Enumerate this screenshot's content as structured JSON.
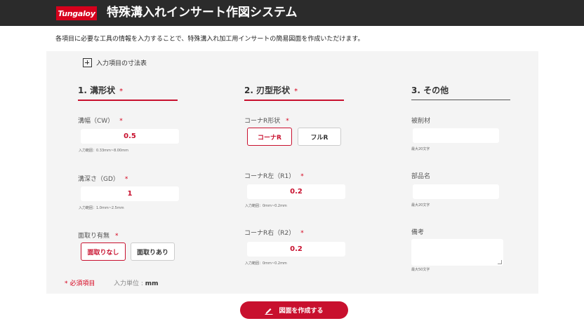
{
  "header": {
    "logo_text": "Tungaloy",
    "title": "特殊溝入れインサート作図システム",
    "bg_color": "#2b2b2b",
    "brand_color": "#d6001c"
  },
  "intro": "各項目に必要な工具の情報を入力することで、特殊溝入れ加工用インサートの簡易図面を作成いただけます。",
  "dims_toggle": {
    "label": "入力項目の寸法表",
    "icon": "plus-square-icon"
  },
  "section1": {
    "title": "1. 溝形状",
    "required_mark": "*",
    "groove_width": {
      "label": "溝幅（CW）",
      "required_mark": "*",
      "value": "0.5",
      "hint": "入力範囲：0.33mm~8.00mm"
    },
    "groove_depth": {
      "label": "溝深さ（GD）",
      "required_mark": "*",
      "value": "1",
      "hint": "入力範囲：1.0mm~2.5mm"
    },
    "chamfer": {
      "label": "面取り有無",
      "required_mark": "*",
      "options": [
        "面取りなし",
        "面取りあり"
      ],
      "selected": "面取りなし"
    }
  },
  "section2": {
    "title": "2. 刃型形状",
    "required_mark": "*",
    "corner_shape": {
      "label": "コーナR形状",
      "required_mark": "*",
      "options": [
        "コーナR",
        "フルR"
      ],
      "selected": "コーナR"
    },
    "corner_left": {
      "label": "コーナR左（R1）",
      "required_mark": "*",
      "value": "0.2",
      "hint": "入力範囲：0mm~0.2mm"
    },
    "corner_right": {
      "label": "コーナR右（R2）",
      "required_mark": "*",
      "value": "0.2",
      "hint": "入力範囲：0mm~0.2mm"
    }
  },
  "section3": {
    "title": "3. その他",
    "work_material": {
      "label": "被削材",
      "value": "",
      "hint": "最大20文字"
    },
    "part_name": {
      "label": "部品名",
      "value": "",
      "hint": "最大20文字"
    },
    "remarks": {
      "label": "備考",
      "value": "",
      "hint": "最大50文字"
    }
  },
  "legend": {
    "required_text": "* 必須項目",
    "unit_label": "入力単位 : ",
    "unit_value": "mm"
  },
  "submit": {
    "label": "図面を作成する",
    "icon": "pencil-icon"
  }
}
